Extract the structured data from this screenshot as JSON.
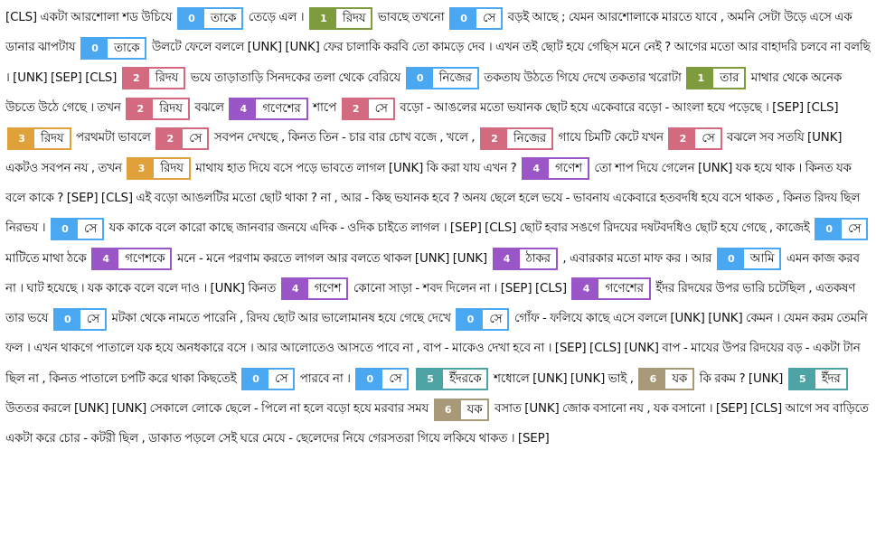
{
  "colors": {
    "0": "#4aa8f2",
    "1": "#7e9c3e",
    "2": "#d46a80",
    "3": "#e0a13a",
    "4": "#9a55c6",
    "5": "#4ea3a5",
    "6": "#a89a78"
  },
  "segments": [
    {
      "t": "[CLS] একটা আরশোলা শড উচিযে "
    },
    {
      "e": "তাকে",
      "c": 0
    },
    {
      "t": " তেড়ে এল । "
    },
    {
      "e": "রিদয",
      "c": 1
    },
    {
      "t": " ভাবছে তখনো "
    },
    {
      "e": "সে",
      "c": 0
    },
    {
      "t": " বড়ই আছে ; যেমন আরশোলাকে মারতে যাবে , অমনি সেটা উড়ে এসে এক ডানার ঝাপটায "
    },
    {
      "e": "তাকে",
      "c": 0
    },
    {
      "t": " উলটে ফেলে বললে [UNK] [UNK] ফের চালাকি করবি তো কামড়ে দেব । এখন তই ছোট হযে গেছিস মনে নেই ? আগের মতো আর বাহাদরি চলবে না বলছি । [UNK] [SEP] [CLS] "
    },
    {
      "e": "রিদয",
      "c": 2
    },
    {
      "t": " ভযে তাড়াতাড়ি সিনদকের তলা থেকে বেরিযে "
    },
    {
      "e": "নিজের",
      "c": 0
    },
    {
      "t": " তকতায উঠতে গিযে দেখে তকতার খরোটা "
    },
    {
      "e": "তার",
      "c": 1
    },
    {
      "t": " মাথার থেকে অনেক উচতে উঠে গেছে । তখন "
    },
    {
      "e": "রিদয",
      "c": 2
    },
    {
      "t": " বঝলে "
    },
    {
      "e": "গণেশের",
      "c": 4
    },
    {
      "t": " শাপে "
    },
    {
      "e": "সে",
      "c": 2
    },
    {
      "t": " বড়ো - আঙলের মতো ভযানক ছোট হযে একেবারে বড়ো - আংলা হযে পড়েছে । [SEP] [CLS] "
    },
    {
      "e": "রিদয",
      "c": 3
    },
    {
      "t": " পরথমটা ভাবলে "
    },
    {
      "e": "সে",
      "c": 2
    },
    {
      "t": " সবপন দেখছে , কিনত তিন - চার বার চোখ বজে , খলে , "
    },
    {
      "e": "নিজের",
      "c": 2
    },
    {
      "t": " গাযে চিমটি কেটে যখন "
    },
    {
      "e": "সে",
      "c": 2
    },
    {
      "t": " বঝলে সব সতযি [UNK] একটও সবপন নয , তখন "
    },
    {
      "e": "রিদয",
      "c": 3
    },
    {
      "t": " মাথায হাত দিযে বসে পড়ে ভাবতে লাগল [UNK] কি করা যায এখন ? "
    },
    {
      "e": "গণেশ",
      "c": 4
    },
    {
      "t": " তো শাপ দিযে গেলেন [UNK] যক হযে থাক । কিনত যক বলে কাকে ? [SEP] [CLS] এই বড়ো আঙলটির মতো ছোট থাকা ? না , আর - কিছ ভযানক হবে ? অনয ছেলে হলে ভযে - ভাবনায একেবারে হতবদধি হযে বসে থাকত , কিনত রিদয ছিল নিরভয । "
    },
    {
      "e": "সে",
      "c": 0
    },
    {
      "t": " যক কাকে বলে কারো কাছে জানবার জনযে এদিক - ওদিক চাইতে লাগল । [SEP] [CLS] ছোট হবার সঙগে রিদযের দষটবদধিও ছোট হযে গেছে , কাজেই "
    },
    {
      "e": "সে",
      "c": 0
    },
    {
      "t": " মাটিতে মাথা ঠকে "
    },
    {
      "e": "গণেশকে",
      "c": 4
    },
    {
      "t": " মনে - মনে পরণাম করতে লাগল আর বলতে থাকল [UNK] [UNK] "
    },
    {
      "e": "ঠাকর",
      "c": 4
    },
    {
      "t": " , এবারকার মতো মাফ কর । আর "
    },
    {
      "e": "আমি",
      "c": 0
    },
    {
      "t": " এমন কাজ করব না । ঘাট হযেছে । যক কাকে বলে বলে দাও । [UNK] কিনত "
    },
    {
      "e": "গণেশ",
      "c": 4
    },
    {
      "t": " কোনো সাড়া - শবদ দিলেন না । [SEP] [CLS] "
    },
    {
      "e": "গণেশের",
      "c": 4
    },
    {
      "t": " ইঁদর রিদযের উপর ভারি চটেছিল , এতকষণ তার ভযে "
    },
    {
      "e": "সে",
      "c": 0
    },
    {
      "t": " মটকা থেকে নামতে পারেনি , রিদয ছোট আর ভালোমানষ হযে গেছে দেখে "
    },
    {
      "e": "সে",
      "c": 0
    },
    {
      "t": " গোঁফ - ফলিযে কাছে এসে বললে [UNK] [UNK] কেমন । যেমন করম তেমনি ফল । এখন থাকগে পাতালে যক হযে অনধকারে বসে । আর আলোতেও আসতে পাবে না , বাপ - মাকেও দেখা হবে না । [SEP] [CLS] [UNK] বাপ - মাযের উপর রিদযের বড় - একটা টান ছিল না , কিনত পাতালে চপটি করে থাকা কিছতেই "
    },
    {
      "e": "সে",
      "c": 0
    },
    {
      "t": " পারবে না । "
    },
    {
      "e": "সে",
      "c": 0
    },
    {
      "t": " "
    },
    {
      "e": "ইঁদরকে",
      "c": 5
    },
    {
      "t": " শধোলে [UNK] [UNK] ভাই , "
    },
    {
      "e": "যক",
      "c": 6
    },
    {
      "t": " কি রকম ? [UNK] "
    },
    {
      "e": "ইঁদর",
      "c": 5
    },
    {
      "t": " উততর করলে [UNK] [UNK] সেকালে লোকে ছেলে - পিলে না হলে বড়ো হযে মরবার সময "
    },
    {
      "e": "যক",
      "c": 6
    },
    {
      "t": " বসাত [UNK] জোক বসানো নয , যক বসানো । [SEP] [CLS] আগে সব বাড়িতে একটা করে চোর - কটরী ছিল , ডাকাত পড়লে সেই ঘরে মেযে - ছেলেদের নিযে গেরসতরা গিযে লকিযে থাকত । [SEP]"
    }
  ]
}
